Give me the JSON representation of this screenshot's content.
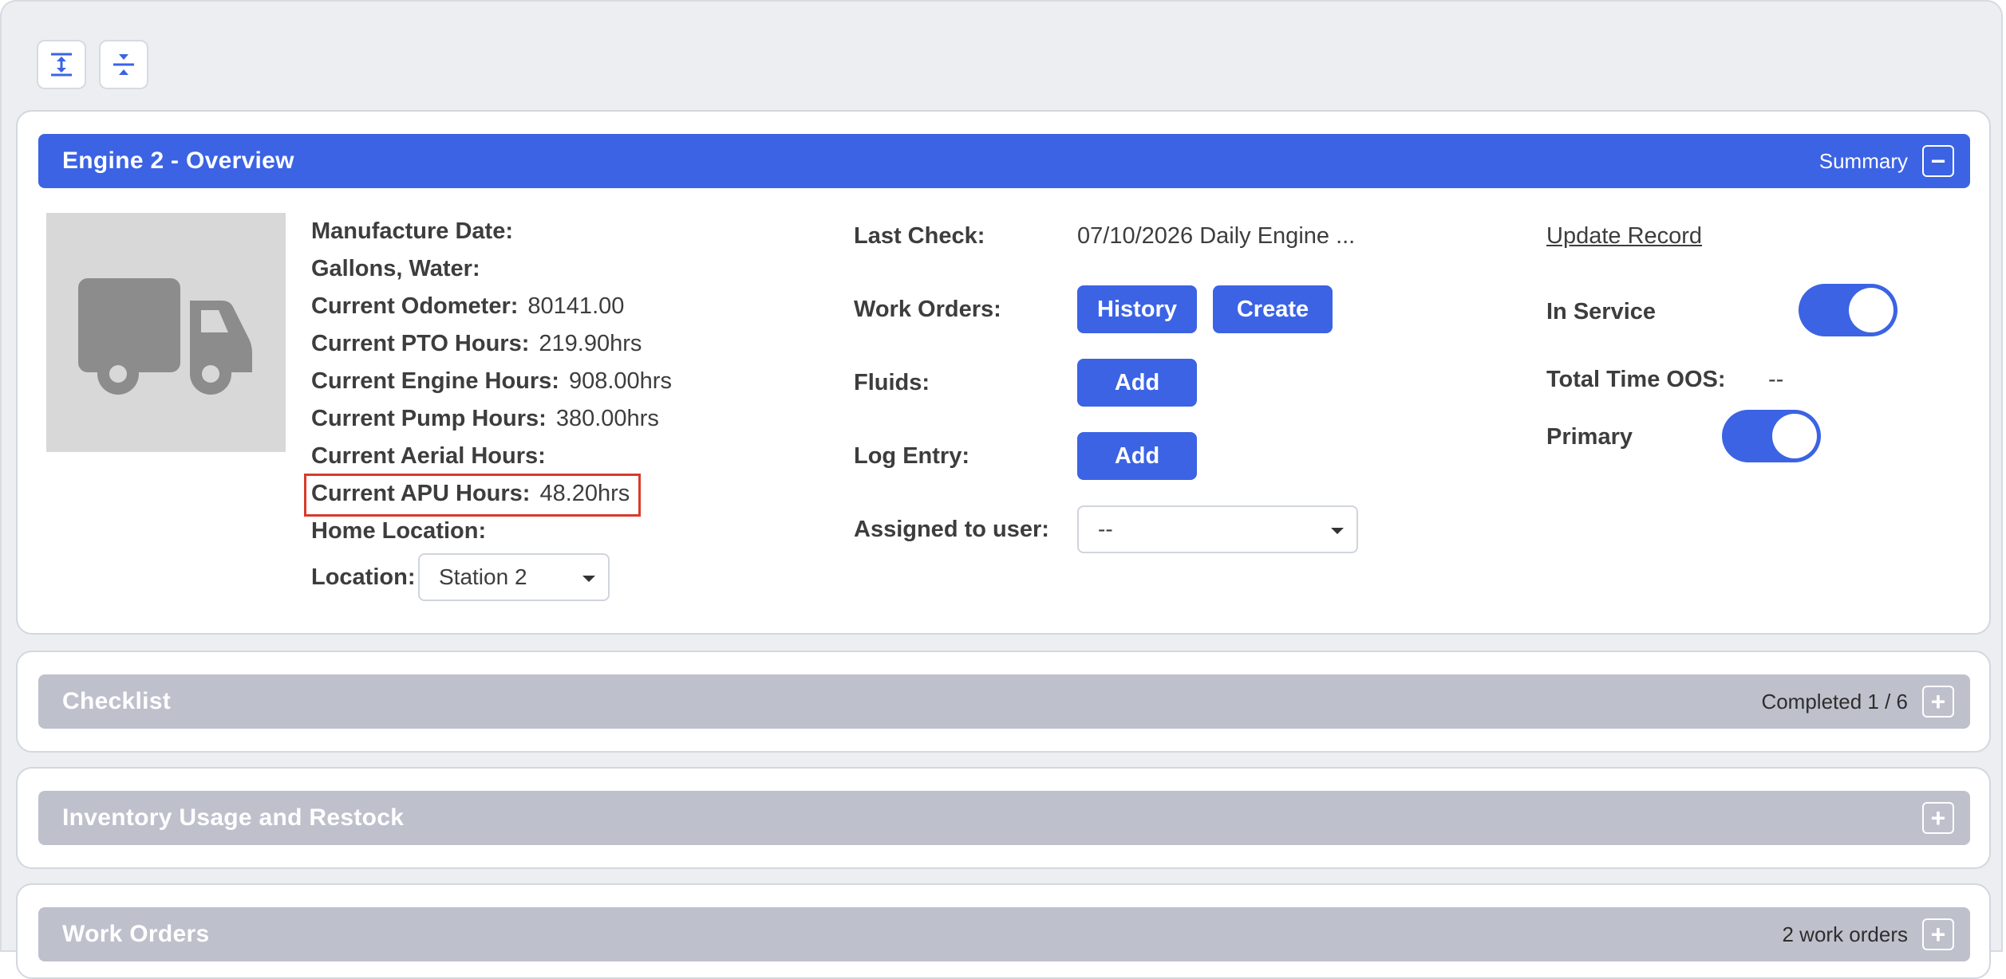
{
  "toolbar": {
    "expand_icon": "expand-all-icon",
    "collapse_icon": "collapse-all-icon"
  },
  "overview": {
    "title": "Engine 2 - Overview",
    "summary_label": "Summary",
    "collapse_symbol": "−",
    "thumbnail_icon": "truck-icon",
    "fields": [
      {
        "label": "Manufacture Date:",
        "value": ""
      },
      {
        "label": "Gallons, Water:",
        "value": ""
      },
      {
        "label": "Current Odometer:",
        "value": "80141.00"
      },
      {
        "label": "Current PTO Hours:",
        "value": "219.90hrs"
      },
      {
        "label": "Current Engine Hours:",
        "value": "908.00hrs"
      },
      {
        "label": "Current Pump Hours:",
        "value": "380.00hrs"
      },
      {
        "label": "Current Aerial Hours:",
        "value": ""
      },
      {
        "label": "Current APU Hours:",
        "value": "48.20hrs"
      },
      {
        "label": "Home Location:",
        "value": ""
      }
    ],
    "location_label": "Location:",
    "location_value": "Station 2",
    "last_check_label": "Last Check:",
    "last_check_value": "07/10/2026 Daily Engine ...",
    "work_orders_label": "Work Orders:",
    "history_button": "History",
    "create_button": "Create",
    "fluids_label": "Fluids:",
    "fluids_button": "Add",
    "log_entry_label": "Log Entry:",
    "log_entry_button": "Add",
    "assigned_label": "Assigned to user:",
    "assigned_value": "--",
    "update_record": "Update Record",
    "in_service_label": "In Service",
    "in_service_on": true,
    "total_oos_label": "Total Time OOS:",
    "total_oos_value": "--",
    "primary_label": "Primary",
    "primary_on": true
  },
  "sections": {
    "checklist": {
      "title": "Checklist",
      "status": "Completed 1 / 6",
      "expand_symbol": "+"
    },
    "inventory": {
      "title": "Inventory Usage and Restock",
      "expand_symbol": "+"
    },
    "work_orders": {
      "title": "Work Orders",
      "status": "2 work orders",
      "expand_symbol": "+"
    }
  },
  "colors": {
    "accent": "#3b63e4",
    "collapsed_bar": "#bec1cc",
    "highlight_border": "#d93a2a"
  }
}
